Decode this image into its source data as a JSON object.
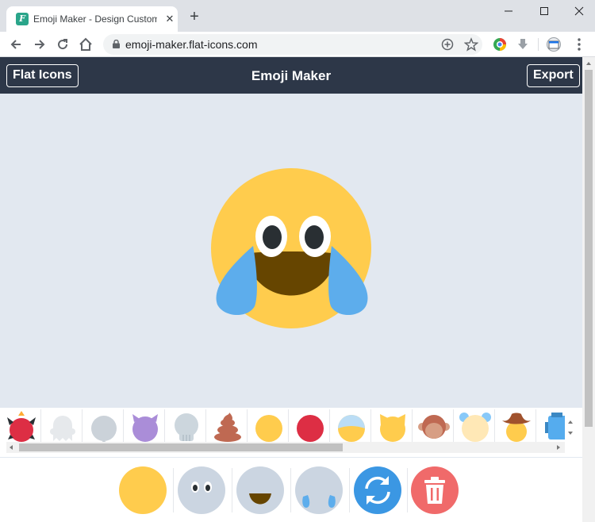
{
  "browser": {
    "tab_title": "Emoji Maker - Design Custom E",
    "favicon_letter": "F",
    "url": "emoji-maker.flat-icons.com",
    "close_glyph": "✕",
    "newtab_glyph": "+"
  },
  "header": {
    "left_button": "Flat Icons",
    "title": "Emoji Maker",
    "right_button": "Export"
  },
  "canvas": {
    "emoji": "laughing-crying-face",
    "colors": {
      "face": "#FFCC4D",
      "eye_white": "#FFFFFF",
      "pupil": "#292F33",
      "mouth": "#664500",
      "tear": "#5DADEC"
    }
  },
  "palette": {
    "items": [
      "devil-red-face-icon",
      "ghost-icon",
      "blank-grey-face-icon",
      "purple-devil-icon",
      "skull-icon",
      "poop-icon",
      "yellow-face-icon",
      "red-face-icon",
      "half-blue-face-icon",
      "cat-face-icon",
      "monkey-face-icon",
      "bear-face-icon",
      "cowboy-hat-face-icon",
      "blue-robot-icon"
    ]
  },
  "actions": [
    {
      "name": "base-color-button",
      "color": "#FFCC4D"
    },
    {
      "name": "eyes-button",
      "color": "#CBD5E1"
    },
    {
      "name": "mouth-button",
      "color": "#CBD5E1"
    },
    {
      "name": "extras-button",
      "color": "#CBD5E1"
    },
    {
      "name": "randomize-button",
      "color": "#3B97E3"
    },
    {
      "name": "delete-button",
      "color": "#F06A6A"
    }
  ]
}
